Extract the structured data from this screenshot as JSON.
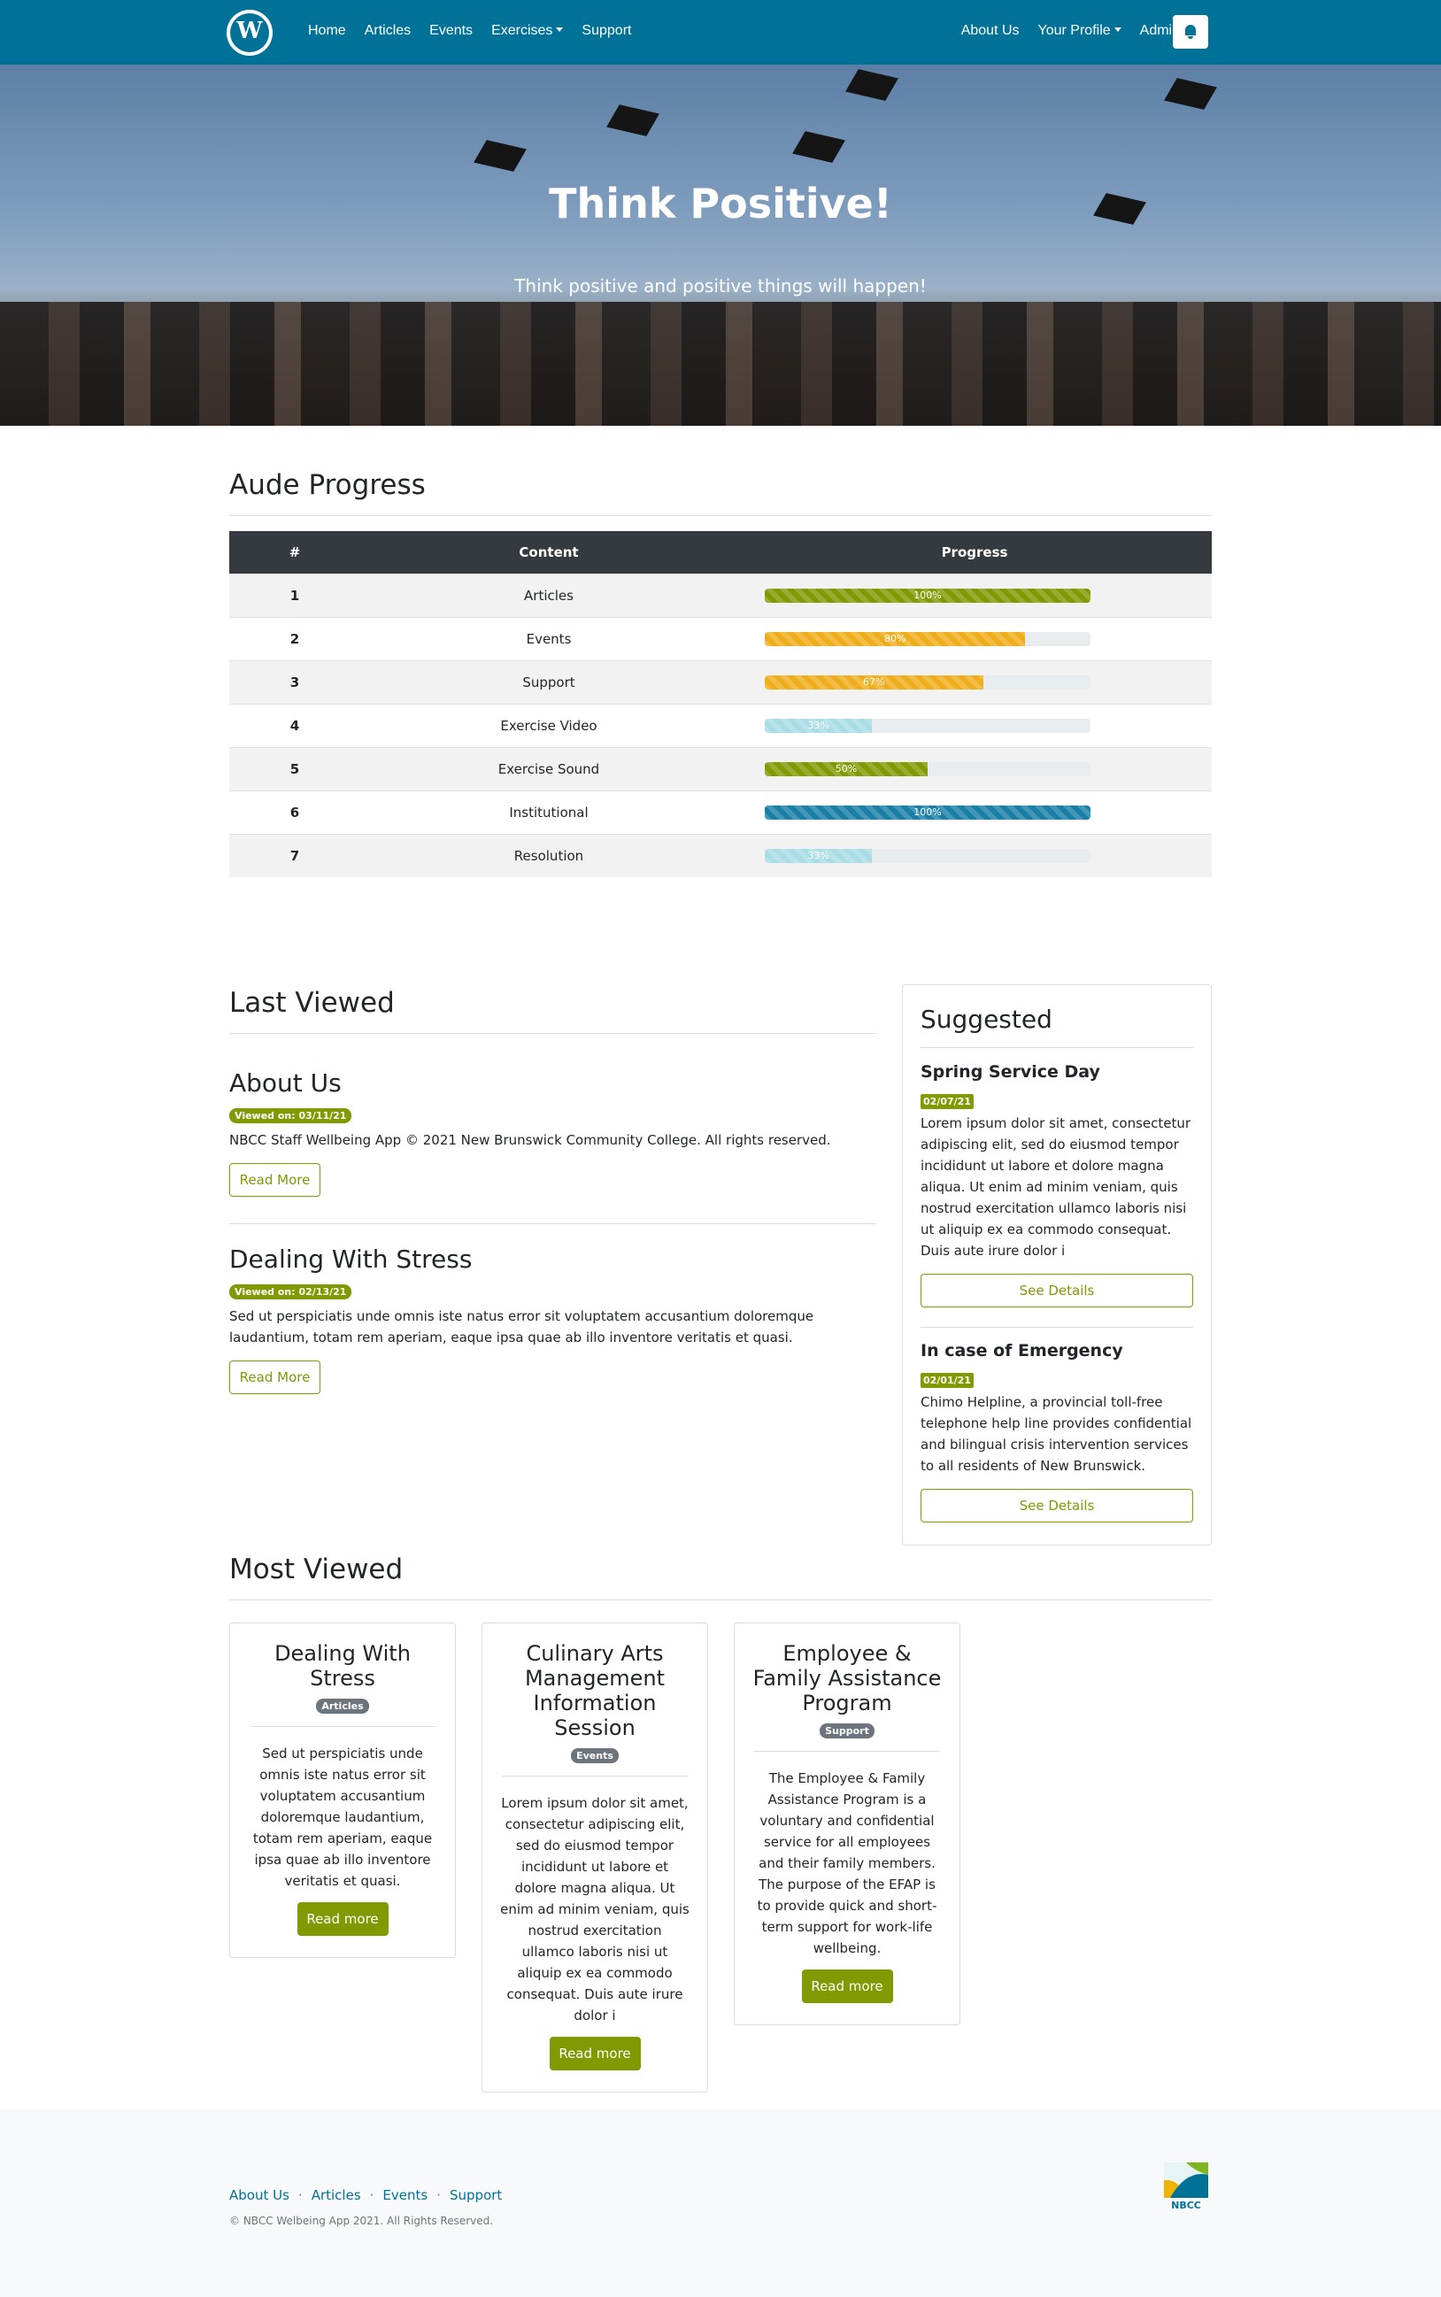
{
  "nav": {
    "links": [
      "Home",
      "Articles",
      "Events",
      "Exercises",
      "Support"
    ],
    "right_links": [
      "About Us",
      "Your Profile",
      "Admin"
    ],
    "logo_icon": "wordpress-logo",
    "bell_icon": "bell-icon"
  },
  "hero": {
    "title": "Think Positive!",
    "subtitle": "Think positive and positive things will happen!"
  },
  "progress": {
    "heading": "Aude Progress",
    "columns": [
      "#",
      "Content",
      "Progress"
    ],
    "rows": [
      {
        "num": "1",
        "content": "Articles",
        "percent": 100,
        "label": "100%",
        "color": "#819a02"
      },
      {
        "num": "2",
        "content": "Events",
        "percent": 80,
        "label": "80%",
        "color": "#f0ad1b"
      },
      {
        "num": "3",
        "content": "Support",
        "percent": 67,
        "label": "67%",
        "color": "#f0ad1b"
      },
      {
        "num": "4",
        "content": "Exercise Video",
        "percent": 33,
        "label": "33%",
        "color": "#a8dde6"
      },
      {
        "num": "5",
        "content": "Exercise Sound",
        "percent": 50,
        "label": "50%",
        "color": "#819a02"
      },
      {
        "num": "6",
        "content": "Institutional",
        "percent": 100,
        "label": "100%",
        "color": "#1a7fa6"
      },
      {
        "num": "7",
        "content": "Resolution",
        "percent": 33,
        "label": "33%",
        "color": "#a8dde6"
      }
    ]
  },
  "last_viewed": {
    "heading": "Last Viewed",
    "items": [
      {
        "title": "About Us",
        "badge": "Viewed on: 03/11/21",
        "text": "NBCC Staff Wellbeing App © 2021 New Brunswick Community College. All rights reserved.",
        "button": "Read More"
      },
      {
        "title": "Dealing With Stress",
        "badge": "Viewed on: 02/13/21",
        "text": "Sed ut perspiciatis unde omnis iste natus error sit voluptatem accusantium doloremque laudantium, totam rem aperiam, eaque ipsa quae ab illo inventore veritatis et quasi.",
        "button": "Read More"
      }
    ]
  },
  "suggested": {
    "heading": "Suggested",
    "items": [
      {
        "title": "Spring Service Day",
        "date": "02/07/21",
        "text": "Lorem ipsum dolor sit amet, consectetur adipiscing elit, sed do eiusmod tempor incididunt ut labore et dolore magna aliqua. Ut enim ad minim veniam, quis nostrud exercitation ullamco laboris nisi ut aliquip ex ea commodo consequat. Duis aute irure dolor i",
        "button": "See Details"
      },
      {
        "title": "In case of Emergency",
        "date": "02/01/21",
        "text": "Chimo Helpline, a provincial toll-free telephone help line provides confidential and bilingual crisis intervention services to all residents of New Brunswick.",
        "button": "See Details"
      }
    ]
  },
  "most_viewed": {
    "heading": "Most Viewed",
    "cards": [
      {
        "title": "Dealing With Stress",
        "badge": "Articles",
        "text": "Sed ut perspiciatis unde omnis iste natus error sit voluptatem accusantium doloremque laudantium, totam rem aperiam, eaque ipsa quae ab illo inventore veritatis et quasi.",
        "button": "Read more"
      },
      {
        "title": "Culinary Arts Management Information Session",
        "badge": "Events",
        "text": "Lorem ipsum dolor sit amet, consectetur adipiscing elit, sed do eiusmod tempor incididunt ut labore et dolore magna aliqua. Ut enim ad minim veniam, quis nostrud exercitation ullamco laboris nisi ut aliquip ex ea commodo consequat. Duis aute irure dolor i",
        "button": "Read more"
      },
      {
        "title": "Employee & Family Assistance Program",
        "badge": "Support",
        "text": "The Employee & Family Assistance Program is a voluntary and confidential service for all employees and their family members. The purpose of the EFAP is to provide quick and short-term support for work-life wellbeing.",
        "button": "Read more"
      }
    ]
  },
  "footer": {
    "links": [
      "About Us",
      "Articles",
      "Events",
      "Support"
    ],
    "copyright": "© NBCC Welbeing App 2021. All Rights Reserved.",
    "logo_text": "NBCC"
  }
}
